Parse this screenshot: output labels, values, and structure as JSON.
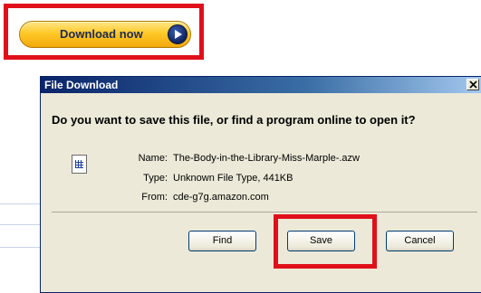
{
  "download_button": {
    "label": "Download now"
  },
  "dialog": {
    "title": "File Download",
    "question": "Do you want to save this file, or find a program online to open it?",
    "file_info": {
      "name_label": "Name:",
      "name_value": "The-Body-in-the-Library-Miss-Marple-.azw",
      "type_label": "Type:",
      "type_value": "Unknown File Type, 441KB",
      "from_label": "From:",
      "from_value": "cde-g7g.amazon.com"
    },
    "buttons": {
      "find": "Find",
      "save": "Save",
      "cancel": "Cancel"
    }
  },
  "colors": {
    "highlight": "#e0101a",
    "titlebar": "#0a246a",
    "dialog_bg": "#ece9d8",
    "button_gold": "#ffc928"
  },
  "icons": {
    "play": "play-circle-icon",
    "close": "close-icon",
    "file": "file-icon"
  }
}
